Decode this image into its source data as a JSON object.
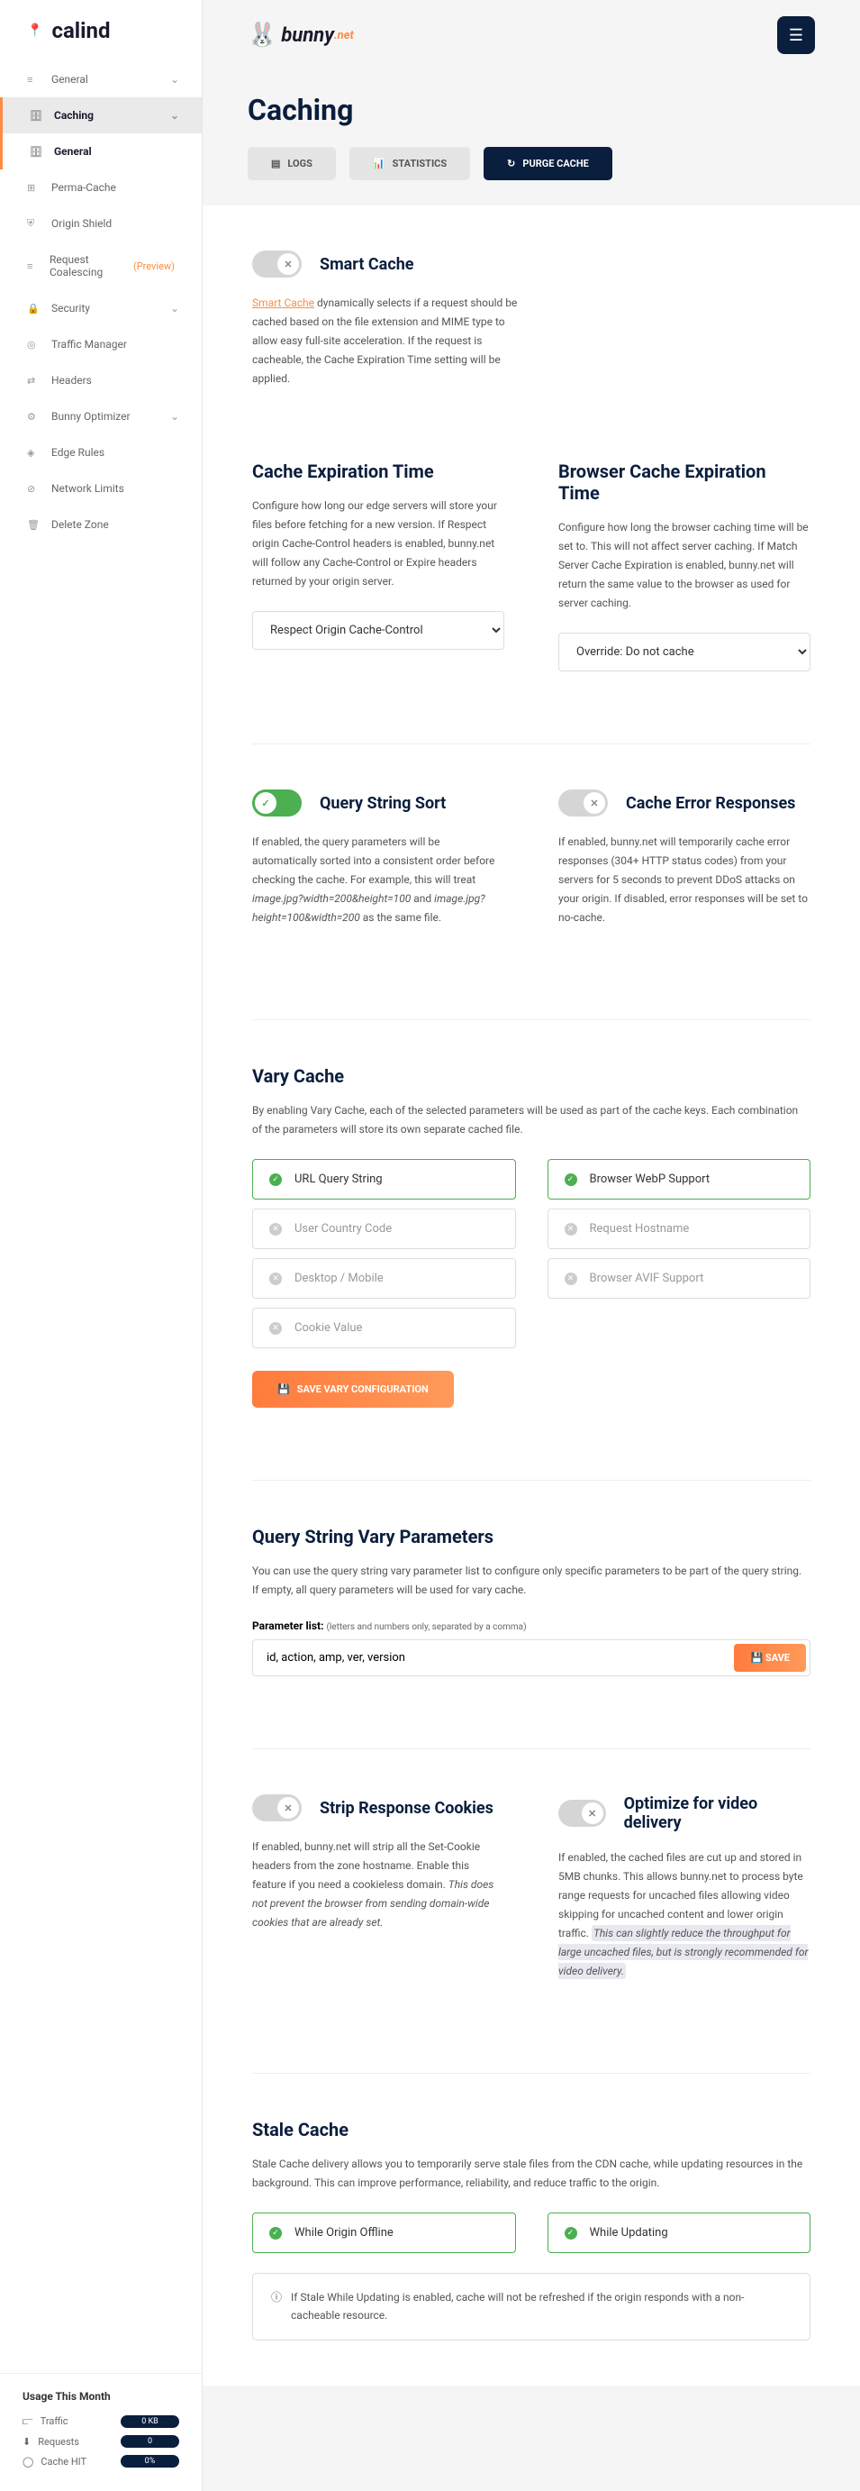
{
  "sidebar": {
    "site_name": "calind",
    "items": [
      {
        "label": "General",
        "icon": "≡"
      },
      {
        "label": "Caching",
        "icon": "🗄"
      },
      {
        "label": "General",
        "icon": "🗄"
      },
      {
        "label": "Perma-Cache",
        "icon": "⊞"
      },
      {
        "label": "Origin Shield",
        "icon": "⛨"
      },
      {
        "label": "Request Coalescing",
        "icon": "≡",
        "preview": "(Preview)"
      },
      {
        "label": "Security",
        "icon": "🔒"
      },
      {
        "label": "Traffic Manager",
        "icon": "◎"
      },
      {
        "label": "Headers",
        "icon": "⇄"
      },
      {
        "label": "Bunny Optimizer",
        "icon": "⚙"
      },
      {
        "label": "Edge Rules",
        "icon": "◈"
      },
      {
        "label": "Network Limits",
        "icon": "⊘"
      },
      {
        "label": "Delete Zone",
        "icon": "🗑"
      }
    ]
  },
  "usage": {
    "title": "Usage This Month",
    "rows": [
      {
        "label": "Traffic",
        "value": "0 KB"
      },
      {
        "label": "Requests",
        "value": "0"
      },
      {
        "label": "Cache HIT",
        "value": "0%"
      }
    ]
  },
  "page": {
    "title": "Caching",
    "tabs": {
      "logs": "LOGS",
      "statistics": "STATISTICS",
      "purge": "PURGE CACHE"
    }
  },
  "smart_cache": {
    "title": "Smart Cache",
    "link_text": "Smart Cache",
    "desc": " dynamically selects if a request should be cached based on the file extension and MIME type to allow easy full-site acceleration. If the request is cacheable, the Cache Expiration Time setting will be applied."
  },
  "cache_exp": {
    "title": "Cache Expiration Time",
    "desc": "Configure how long our edge servers will store your files before fetching for a new version. If Respect origin Cache-Control headers is enabled, bunny.net will follow any Cache-Control or Expire headers returned by your origin server.",
    "value": "Respect Origin Cache-Control"
  },
  "browser_cache": {
    "title": "Browser Cache Expiration Time",
    "desc": "Configure how long the browser caching time will be set to. This will not affect server caching. If Match Server Cache Expiration is enabled, bunny.net will return the same value to the browser as used for server caching.",
    "value": "Override: Do not cache"
  },
  "qs_sort": {
    "title": "Query String Sort",
    "desc_p1": "If enabled, the query parameters will be automatically sorted into a consistent order before checking the cache. For example, this will treat ",
    "ex1": "image.jpg?width=200&height=100",
    "desc_p2": " and ",
    "ex2": "image.jpg?height=100&width=200",
    "desc_p3": " as the same file."
  },
  "cache_err": {
    "title": "Cache Error Responses",
    "desc": "If enabled, bunny.net will temporarily cache error responses (304+ HTTP status codes) from your servers for 5 seconds to prevent DDoS attacks on your origin. If disabled, error responses will be set to no-cache."
  },
  "vary": {
    "title": "Vary Cache",
    "desc": "By enabling Vary Cache, each of the selected parameters will be used as part of the cache keys. Each combination of the parameters will store its own separate cached file.",
    "chips_left": [
      "URL Query String",
      "User Country Code",
      "Desktop / Mobile",
      "Cookie Value"
    ],
    "chips_right": [
      "Browser WebP Support",
      "Request Hostname",
      "Browser AVIF Support"
    ],
    "save_btn": "SAVE VARY CONFIGURATION"
  },
  "qs_vary": {
    "title": "Query String Vary Parameters",
    "desc": "You can use the query string vary parameter list to configure only specific parameters to be part of the query string. If empty, all query parameters will be used for vary cache.",
    "label": "Parameter list:",
    "hint": "(letters and numbers only, separated by a comma)",
    "value": "id, action, amp, ver, version",
    "save_btn": "SAVE"
  },
  "strip": {
    "title": "Strip Response Cookies",
    "desc_p1": "If enabled, bunny.net will strip all the Set-Cookie headers from the zone hostname. Enable this feature if you need a cookieless domain.  ",
    "desc_it": "This does not prevent the browser from sending domain-wide cookies that are already set."
  },
  "video": {
    "title": "Optimize for video delivery",
    "desc_p1": "If enabled, the cached files are cut up and stored in 5MB chunks. This allows bunny.net to process byte range requests for uncached files allowing video skipping for uncached content and lower origin traffic.  ",
    "desc_it": "This can slightly reduce the throughput for large uncached files, but is strongly recommended for video delivery."
  },
  "stale": {
    "title": "Stale Cache",
    "desc": "Stale Cache delivery allows you to temporarily serve stale files from the CDN cache, while updating resources in the background. This can improve performance, reliability, and reduce traffic to the origin.",
    "chip1": "While Origin Offline",
    "chip2": "While Updating",
    "info": "If Stale While Updating is enabled, cache will not be refreshed if the origin responds with a non-cacheable resource."
  }
}
